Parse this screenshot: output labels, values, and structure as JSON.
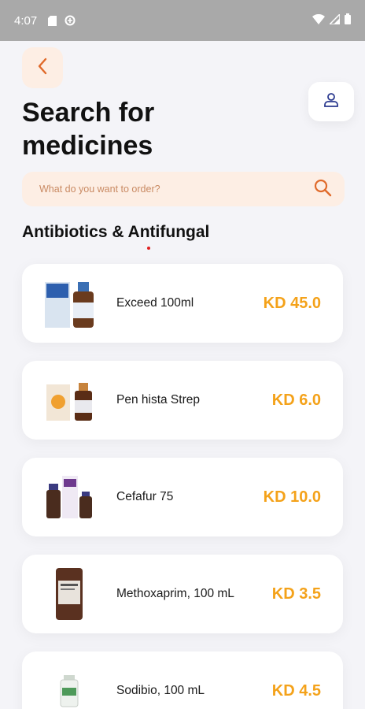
{
  "status_bar": {
    "time": "4:07"
  },
  "header": {
    "title": "Search for medicines",
    "back_icon": "chevron-left-icon",
    "profile_icon": "user-icon"
  },
  "search": {
    "placeholder": "What do you want to order?",
    "icon": "search-icon"
  },
  "section": {
    "title": "Antibiotics & Antifungal"
  },
  "colors": {
    "accent": "#f4a21a",
    "search_bg": "#fdeee4",
    "back_chevron": "#e06a2a"
  },
  "products": [
    {
      "name": "Exceed 100ml",
      "price": "KD 45.0"
    },
    {
      "name": "Pen hista Strep",
      "price": "KD 6.0"
    },
    {
      "name": "Cefafur 75",
      "price": "KD 10.0"
    },
    {
      "name": "Methoxaprim, 100 mL",
      "price": "KD 3.5"
    },
    {
      "name": "Sodibio, 100 mL",
      "price": "KD 4.5"
    }
  ]
}
